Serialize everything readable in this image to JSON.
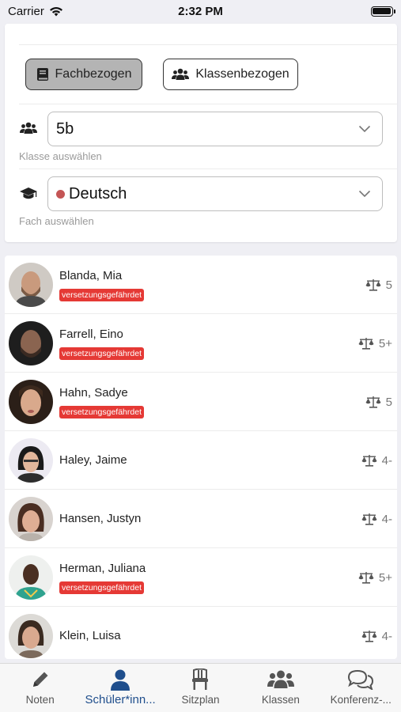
{
  "status_bar": {
    "carrier": "Carrier",
    "time": "2:32 PM"
  },
  "filter": {
    "mode_buttons": [
      {
        "label": "Fachbezogen",
        "active": true,
        "icon": "book-icon"
      },
      {
        "label": "Klassenbezogen",
        "active": false,
        "icon": "users-icon"
      }
    ],
    "class_select": {
      "value": "5b",
      "helper": "Klasse auswählen",
      "icon": "users-icon"
    },
    "subject_select": {
      "value": "Deutsch",
      "helper": "Fach auswählen",
      "icon": "graduation-cap-icon",
      "color": "#c45555"
    }
  },
  "students": [
    {
      "name": "Blanda, Mia",
      "badge": "versetzungsgefährdet",
      "grade": "5"
    },
    {
      "name": "Farrell, Eino",
      "badge": "versetzungsgefährdet",
      "grade": "5+"
    },
    {
      "name": "Hahn, Sadye",
      "badge": "versetzungsgefährdet",
      "grade": "5"
    },
    {
      "name": "Haley, Jaime",
      "badge": "",
      "grade": "4-"
    },
    {
      "name": "Hansen, Justyn",
      "badge": "",
      "grade": "4-"
    },
    {
      "name": "Herman, Juliana",
      "badge": "versetzungsgefährdet",
      "grade": "5+"
    },
    {
      "name": "Klein, Luisa",
      "badge": "",
      "grade": "4-"
    }
  ],
  "tabs": [
    {
      "label": "Noten",
      "icon": "pencil-icon",
      "active": false
    },
    {
      "label": "Schüler*inn...",
      "icon": "person-icon",
      "active": true
    },
    {
      "label": "Sitzplan",
      "icon": "chair-icon",
      "active": false
    },
    {
      "label": "Klassen",
      "icon": "users-icon",
      "active": false
    },
    {
      "label": "Konferenz-...",
      "icon": "chat-bubbles-icon",
      "active": false
    }
  ],
  "colors": {
    "accent": "#1f4e8c",
    "badge": "#e53935",
    "background": "#efeff4"
  }
}
